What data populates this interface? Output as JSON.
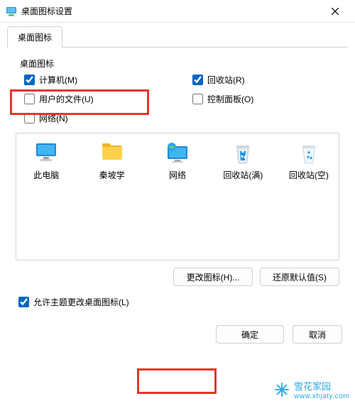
{
  "window": {
    "title": "桌面图标设置"
  },
  "tab": {
    "label": "桌面图标"
  },
  "group": {
    "label": "桌面图标"
  },
  "chk": {
    "computer": {
      "label": "计算机(M)",
      "checked": true
    },
    "recycle": {
      "label": "回收站(R)",
      "checked": true
    },
    "userfiles": {
      "label": "用户的文件(U)",
      "checked": false
    },
    "cpanel": {
      "label": "控制面板(O)",
      "checked": false
    },
    "network": {
      "label": "网络(N)",
      "checked": false
    }
  },
  "icons": {
    "this_pc": {
      "label": "此电脑"
    },
    "qinpo": {
      "label": "秦坡学"
    },
    "network": {
      "label": "网络"
    },
    "bin_full": {
      "label": "回收站(满)"
    },
    "bin_empty": {
      "label": "回收站(空)"
    }
  },
  "buttons": {
    "change_icon": "更改图标(H)...",
    "restore": "还原默认值(S)",
    "ok": "确定",
    "cancel": "取消"
  },
  "allow_theme": {
    "label": "允许主题更改桌面图标(L)",
    "checked": true
  },
  "watermark": {
    "line1": "雪花家园",
    "line2": "www.xhjaty.com"
  }
}
